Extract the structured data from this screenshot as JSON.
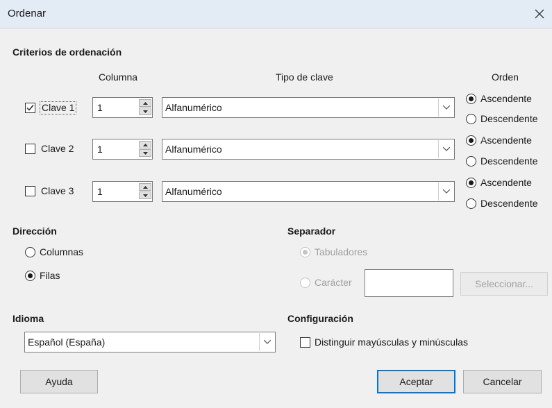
{
  "window": {
    "title": "Ordenar"
  },
  "criteria": {
    "section_title": "Criterios de ordenación",
    "header_column": "Columna",
    "header_key_type": "Tipo de clave",
    "header_order": "Orden",
    "keys": [
      {
        "label": "Clave 1",
        "checked": true,
        "column": "1",
        "key_type": "Alfanumérico",
        "asc_label": "Ascendente",
        "desc_label": "Descendente",
        "order": "asc"
      },
      {
        "label": "Clave 2",
        "checked": false,
        "column": "1",
        "key_type": "Alfanumérico",
        "asc_label": "Ascendente",
        "desc_label": "Descendente",
        "order": "asc"
      },
      {
        "label": "Clave 3",
        "checked": false,
        "column": "1",
        "key_type": "Alfanumérico",
        "asc_label": "Ascendente",
        "desc_label": "Descendente",
        "order": "asc"
      }
    ]
  },
  "direction": {
    "section_title": "Dirección",
    "columns_label": "Columnas",
    "rows_label": "Filas",
    "selected": "rows"
  },
  "separator": {
    "section_title": "Separador",
    "tabs_label": "Tabuladores",
    "char_label": "Carácter",
    "char_value": "",
    "select_button": "Seleccionar..."
  },
  "language": {
    "section_title": "Idioma",
    "value": "Español (España)"
  },
  "config": {
    "section_title": "Configuración",
    "case_label": "Distinguir mayúsculas y minúsculas",
    "case_checked": false
  },
  "footer": {
    "help": "Ayuda",
    "ok": "Aceptar",
    "cancel": "Cancelar"
  }
}
